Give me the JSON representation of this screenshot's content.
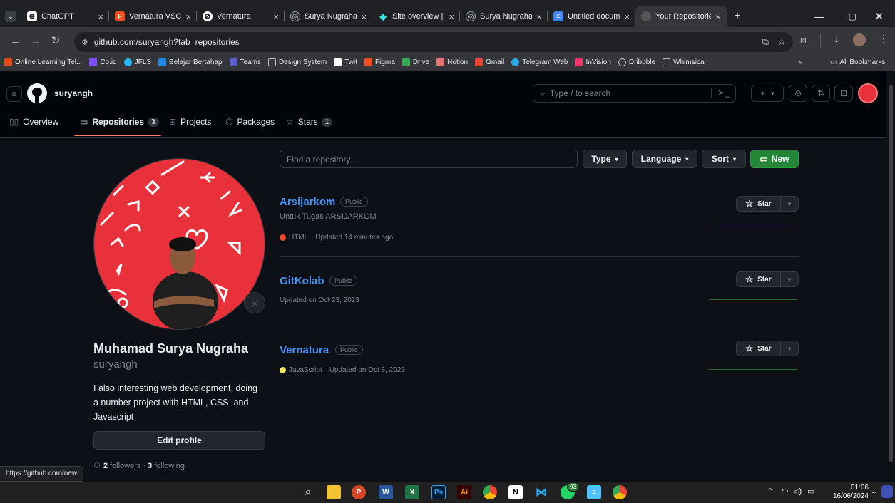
{
  "browser": {
    "tabs": [
      {
        "title": "ChatGPT",
        "icon": "chatgpt-icon",
        "color": "#ffffff"
      },
      {
        "title": "Vernatura VSCOI",
        "icon": "figma-icon",
        "color": "#f24e1e"
      },
      {
        "title": "Vernatura",
        "icon": "vernatura-icon",
        "color": "#ffffff"
      },
      {
        "title": "Surya Nugraha",
        "icon": "globe-icon",
        "color": "#9aa0a6"
      },
      {
        "title": "Site overview | n",
        "icon": "netlify-icon",
        "color": "#32e6e2"
      },
      {
        "title": "Surya Nugraha",
        "icon": "globe-icon",
        "color": "#9aa0a6"
      },
      {
        "title": "Untitled docume",
        "icon": "docs-icon",
        "color": "#4285f4"
      },
      {
        "title": "Your Repositorie",
        "icon": "github-icon",
        "color": "#ffffff"
      }
    ],
    "url": "github.com/suryangh?tab=repositories",
    "bookmarks": [
      {
        "label": "Online Learning Tel...",
        "color": "#e64a19"
      },
      {
        "label": "Co.id",
        "color": "#7c4dff"
      },
      {
        "label": "JFLS",
        "color": "#29b6f6"
      },
      {
        "label": "Belajar Bertahap",
        "color": "#1e88e5"
      },
      {
        "label": "Teams",
        "color": "#5b5fc7"
      },
      {
        "label": "Design System",
        "color": "#bdbdbd"
      },
      {
        "label": "Twit",
        "color": "#ffffff"
      },
      {
        "label": "Figma",
        "color": "#f24e1e"
      },
      {
        "label": "Drive",
        "color": "#34a853"
      },
      {
        "label": "Notion",
        "color": "#e57373"
      },
      {
        "label": "Gmail",
        "color": "#ea4335"
      },
      {
        "label": "Telegram Web",
        "color": "#29a9eb"
      },
      {
        "label": "InVision",
        "color": "#ff3366"
      },
      {
        "label": "Dribbble",
        "color": "#bdbdbd"
      },
      {
        "label": "Whimsical",
        "color": "#bdbdbd"
      }
    ],
    "all_bookmarks": "All Bookmarks",
    "status_url": "https://github.com/new"
  },
  "header": {
    "username": "suryangh",
    "search_placeholder": "Type / to search"
  },
  "nav": {
    "overview": "Overview",
    "repositories": "Repositories",
    "repositories_count": "3",
    "projects": "Projects",
    "packages": "Packages",
    "stars": "Stars",
    "stars_count": "1"
  },
  "profile": {
    "name": "Muhamad Surya Nugraha",
    "login": "suryangh",
    "bio": "I also interesting web development, doing a number project with HTML, CSS, and Javascript",
    "edit_button": "Edit profile",
    "followers_count": "2",
    "followers_label": "followers",
    "following_count": "3",
    "following_label": "following",
    "avatar_bg": "#e8313a"
  },
  "filters": {
    "find_placeholder": "Find a repository...",
    "type": "Type",
    "language": "Language",
    "sort": "Sort",
    "new": "New"
  },
  "repos": [
    {
      "name": "Arsijarkom",
      "visibility": "Public",
      "description": "Untuk Tugas ARSIJARKOM",
      "language": "HTML",
      "language_color": "#e34c26",
      "updated": "Updated 14 minutes ago",
      "star": "Star"
    },
    {
      "name": "GitKolab",
      "visibility": "Public",
      "description": "",
      "language": "",
      "language_color": "",
      "updated": "Updated on Oct 23, 2023",
      "star": "Star"
    },
    {
      "name": "Vernatura",
      "visibility": "Public",
      "description": "",
      "language": "JavaScript",
      "language_color": "#f1e05a",
      "updated": "Updated on Oct 3, 2023",
      "star": "Star"
    }
  ],
  "taskbar": {
    "time": "01:06",
    "date": "16/06/2024",
    "whatsapp_badge": "93"
  }
}
